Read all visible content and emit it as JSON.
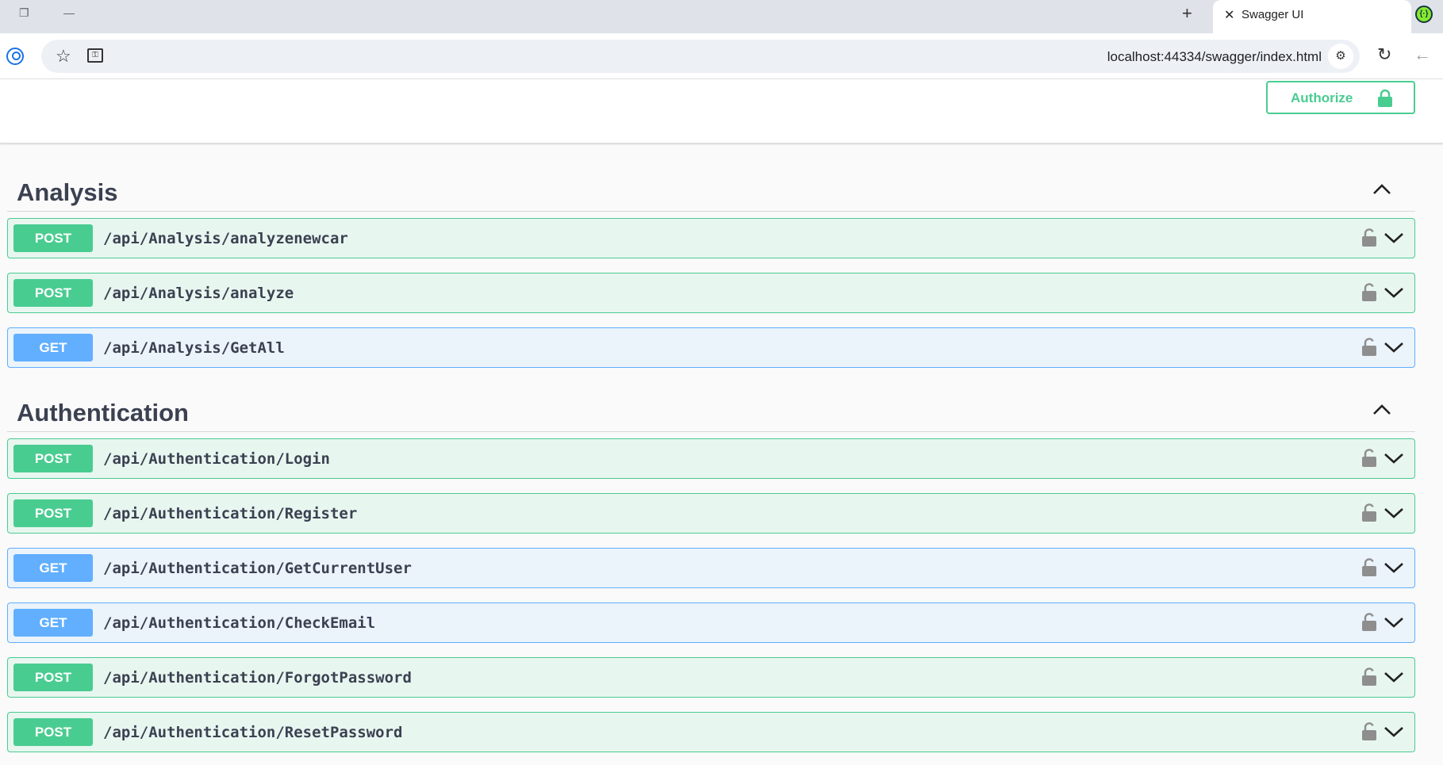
{
  "browser": {
    "tab_title": "Swagger UI",
    "new_tab_icon": "plus-icon",
    "close_icon": "close-icon",
    "url": "localhost:44334/swagger/index.html"
  },
  "swagger": {
    "authorize_label": "Authorize",
    "colors": {
      "post": "#49cc90",
      "get": "#61affe",
      "post_bg": "#e8f6f0",
      "get_bg": "#ebf3fb",
      "text": "#3b4151"
    },
    "sections": [
      {
        "name": "Analysis",
        "operations": [
          {
            "method": "POST",
            "path": "/api/Analysis/analyzenewcar"
          },
          {
            "method": "POST",
            "path": "/api/Analysis/analyze"
          },
          {
            "method": "GET",
            "path": "/api/Analysis/GetAll"
          }
        ]
      },
      {
        "name": "Authentication",
        "operations": [
          {
            "method": "POST",
            "path": "/api/Authentication/Login"
          },
          {
            "method": "POST",
            "path": "/api/Authentication/Register"
          },
          {
            "method": "GET",
            "path": "/api/Authentication/GetCurrentUser"
          },
          {
            "method": "GET",
            "path": "/api/Authentication/CheckEmail"
          },
          {
            "method": "POST",
            "path": "/api/Authentication/ForgotPassword"
          },
          {
            "method": "POST",
            "path": "/api/Authentication/ResetPassword"
          }
        ]
      }
    ]
  }
}
